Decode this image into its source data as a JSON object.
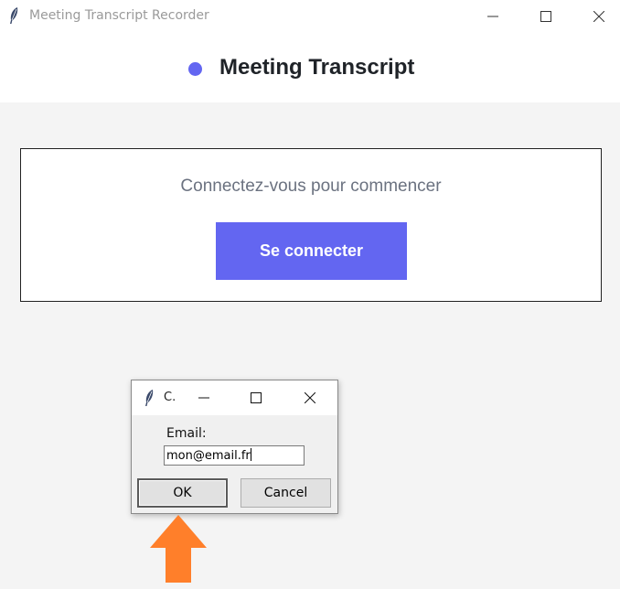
{
  "window": {
    "title": "Meeting Transcript Recorder",
    "icon": "feather-icon",
    "controls": [
      "minimize-icon",
      "maximize-icon",
      "close-icon"
    ]
  },
  "header": {
    "title": "Meeting Transcript",
    "dot_color": "#6366f1"
  },
  "login_card": {
    "prompt": "Connectez-vous pour commencer",
    "button_label": "Se connecter",
    "button_color": "#6366f1"
  },
  "dialog": {
    "title": "C.",
    "icon": "feather-icon",
    "email_label": "Email:",
    "email_value": "mon@email.fr",
    "ok_label": "OK",
    "cancel_label": "Cancel"
  },
  "annotation": {
    "arrow_color": "#ff7f2a",
    "icon": "up-arrow-icon"
  }
}
